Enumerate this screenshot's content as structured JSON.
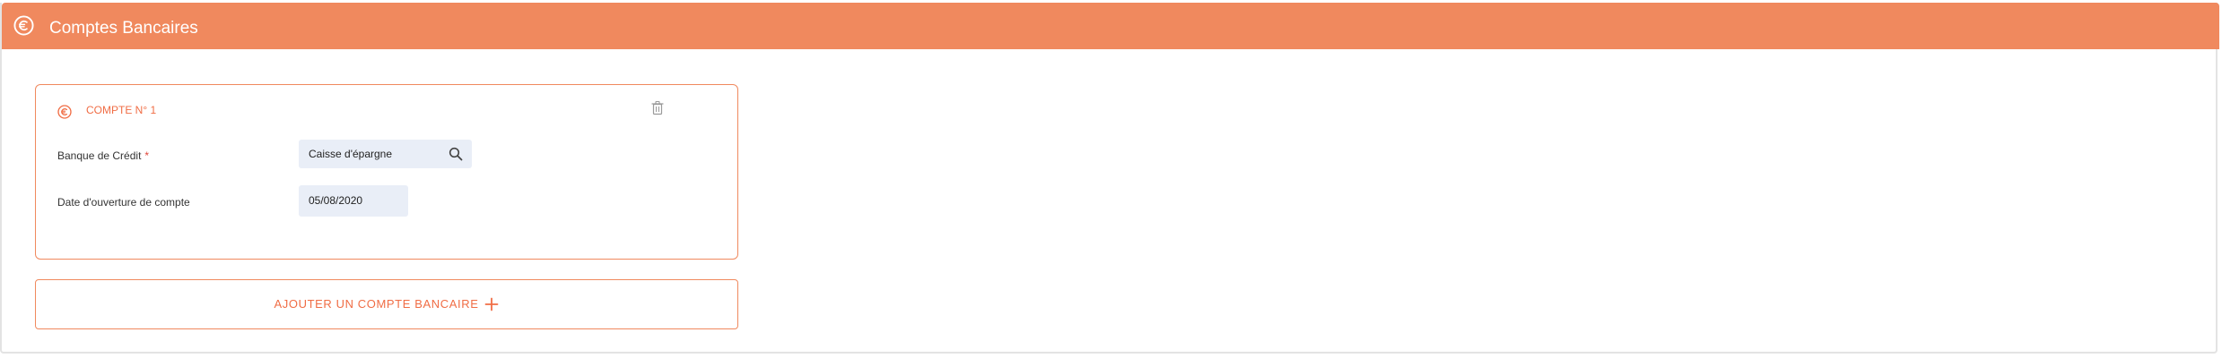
{
  "header": {
    "title": "Comptes Bancaires",
    "icon": "euro-circle-icon",
    "background_color": "#f0895e"
  },
  "accounts": [
    {
      "title": "COMPTE N° 1",
      "icon": "euro-circle-icon",
      "delete_icon": "trash-icon",
      "fields": {
        "bank": {
          "label": "Banque de Crédit",
          "required_marker": "*",
          "value": "Caisse d'épargne",
          "icon": "search-icon"
        },
        "opening_date": {
          "label": "Date d'ouverture de compte",
          "value": "05/08/2020"
        }
      }
    }
  ],
  "add_account_button": {
    "label": "AJOUTER UN COMPTE BANCAIRE",
    "icon": "plus-icon"
  },
  "colors": {
    "accent": "#f0895e",
    "accent_text": "#f06d45",
    "input_background": "#e9eef7",
    "required": "#e0463a"
  }
}
